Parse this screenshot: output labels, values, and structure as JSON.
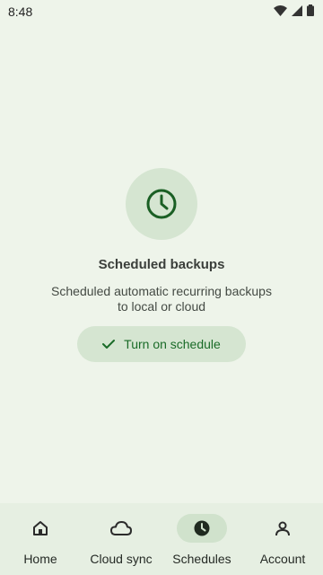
{
  "status_bar": {
    "time": "8:48"
  },
  "empty_state": {
    "title": "Scheduled backups",
    "description_line1": "Scheduled automatic recurring backups",
    "description_line2": "to local or cloud",
    "icon": "clock-icon"
  },
  "cta": {
    "label": "Turn on schedule",
    "icon": "check-icon"
  },
  "bottom_nav": {
    "items": [
      {
        "label": "Home",
        "icon": "home-icon"
      },
      {
        "label": "Cloud sync",
        "icon": "cloud-icon"
      },
      {
        "label": "Schedules",
        "icon": "clock-icon",
        "active": true
      },
      {
        "label": "Account",
        "icon": "account-icon"
      }
    ]
  },
  "colors": {
    "accent": "#1a6b28",
    "background": "#eef4ea",
    "chip": "#d5e5d1"
  }
}
